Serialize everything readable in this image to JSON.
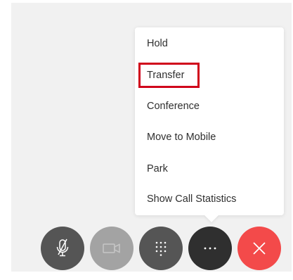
{
  "menu": {
    "items": [
      {
        "label": "Hold"
      },
      {
        "label": "Transfer"
      },
      {
        "label": "Conference"
      },
      {
        "label": "Move to Mobile"
      },
      {
        "label": "Park"
      },
      {
        "label": "Show Call Statistics"
      }
    ],
    "highlighted_item": "Transfer",
    "highlight_color": "#d0021b"
  },
  "controls": [
    {
      "name": "mute-button",
      "icon": "microphone-muted-icon",
      "color": "#555555"
    },
    {
      "name": "video-button",
      "icon": "video-camera-icon",
      "color": "#a3a3a3"
    },
    {
      "name": "keypad-button",
      "icon": "dialpad-icon",
      "color": "#555555"
    },
    {
      "name": "more-button",
      "icon": "more-dots-icon",
      "color": "#2f2f2f"
    },
    {
      "name": "end-call-button",
      "icon": "close-icon",
      "color": "#f34a4a"
    }
  ]
}
